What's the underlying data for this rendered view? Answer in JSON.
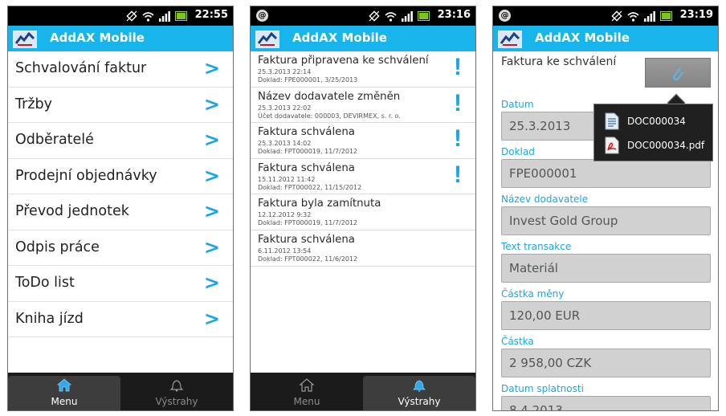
{
  "common": {
    "app_title": "AddAX Mobile",
    "tabs": {
      "menu": "Menu",
      "alerts": "Výstrahy"
    }
  },
  "screen1": {
    "time": "22:55",
    "menu_items": [
      "Schvalování faktur",
      "Tržby",
      "Odběratelé",
      "Prodejní objednávky",
      "Převod jednotek",
      "Odpis práce",
      "ToDo list",
      "Kniha jízd"
    ],
    "chevron": ">",
    "active_tab": "menu"
  },
  "screen2": {
    "time": "23:16",
    "alerts": [
      {
        "title": "Faktura připravena ke schválení",
        "date": "25.3.2013 22:14",
        "detail": "Doklad: FPE000001, 3/25/2013",
        "flag": "!"
      },
      {
        "title": "Název dodavatele změněn",
        "date": "25.3.2013 22:02",
        "detail": "Účet dodavatele: 000003, DEVIRMEX, s. r. o.",
        "flag": "!"
      },
      {
        "title": "Faktura schválena",
        "date": "25.3.2013 14:02",
        "detail": "Doklad: FPT000019, 11/7/2012",
        "flag": "!"
      },
      {
        "title": "Faktura schválena",
        "date": "15.11.2012 11:42",
        "detail": "Doklad: FPT000022, 11/15/2012",
        "flag": "!"
      },
      {
        "title": "Faktura byla zamítnuta",
        "date": "12.12.2012 9:32",
        "detail": "Doklad: FPT000019, 11/7/2012",
        "flag": ""
      },
      {
        "title": "Faktura schválena",
        "date": "6.11.2012 13:54",
        "detail": "Doklad: FPT000022, 11/6/2012",
        "flag": ""
      }
    ],
    "active_tab": "alerts"
  },
  "screen3": {
    "time": "23:19",
    "heading": "Faktura ke schválení",
    "attachments": [
      "DOC000034",
      "DOC000034.pdf"
    ],
    "fields": [
      {
        "label": "Datum",
        "value": "25.3.2013"
      },
      {
        "label": "Doklad",
        "value": "FPE000001"
      },
      {
        "label": "Název dodavatele",
        "value": "Invest Gold Group"
      },
      {
        "label": "Text transakce",
        "value": "Materiál"
      },
      {
        "label": "Částka měny",
        "value": "120,00 EUR"
      },
      {
        "label": "Částka",
        "value": "2 958,00 CZK"
      },
      {
        "label": "Datum splatnosti",
        "value": "8.4.2013"
      }
    ]
  },
  "colors": {
    "accent": "#18b4ec",
    "chevron": "#1aa6e4",
    "status_bar": "#000000",
    "tab_bar": "#1b1b1b",
    "field_bg": "#d1d1d1"
  },
  "icons": {
    "status": [
      "rotate-icon",
      "wifi-icon",
      "signal-icon",
      "battery-icon"
    ],
    "app_logo": "addax-logo-icon",
    "tab_menu": "home-icon",
    "tab_alerts": "bell-icon",
    "attach": "paperclip-icon",
    "popup_doc": "document-icon",
    "popup_pdf": "pdf-icon"
  }
}
